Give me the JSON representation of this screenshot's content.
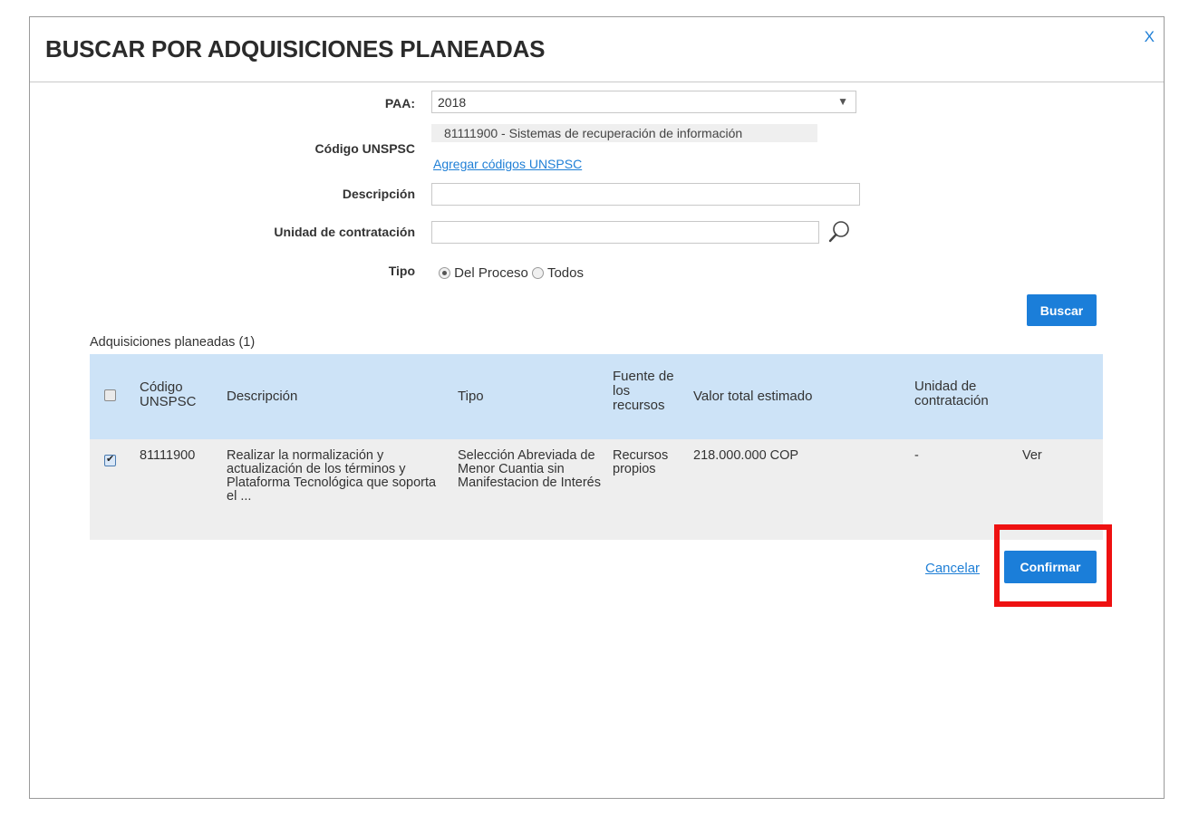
{
  "dialog": {
    "title": "BUSCAR POR ADQUISICIONES PLANEADAS",
    "close_label": "X"
  },
  "form": {
    "paa_label": "PAA:",
    "paa_value": "2018",
    "unspsc_label": "Código UNSPSC",
    "unspsc_selected": "81111900 - Sistemas de recuperación de información",
    "unspsc_add_link": "Agregar códigos UNSPSC",
    "descripcion_label": "Descripción",
    "descripcion_value": "",
    "unidad_label": "Unidad de contratación",
    "unidad_value": "",
    "tipo_label": "Tipo",
    "tipo_options": [
      "Del Proceso",
      "Todos"
    ],
    "tipo_selected": "Del Proceso",
    "search_button": "Buscar"
  },
  "results": {
    "heading": "Adquisiciones planeadas (1)",
    "columns": {
      "codigo": "Código UNSPSC",
      "descripcion": "Descripción",
      "tipo": "Tipo",
      "fuente": "Fuente de los recursos",
      "valor": "Valor total estimado",
      "unidad": "Unidad de contratación"
    },
    "rows": [
      {
        "checked": true,
        "codigo": "81111900",
        "descripcion": "Realizar la normalización y actualización de los términos y Plataforma Tecnológica que soporta el ...",
        "tipo": "Selección Abreviada de Menor Cuantia sin Manifestacion de Interés",
        "fuente": "Recursos propios",
        "valor": "218.000.000 COP",
        "unidad": "-",
        "ver_link": "Ver"
      }
    ]
  },
  "footer": {
    "cancel_link": "Cancelar",
    "confirm_button": "Confirmar"
  },
  "colors": {
    "accent": "#1b7ed9",
    "table_header_bg": "#cde3f7",
    "row_bg": "#eeeeee",
    "highlight": "#ee1111"
  }
}
